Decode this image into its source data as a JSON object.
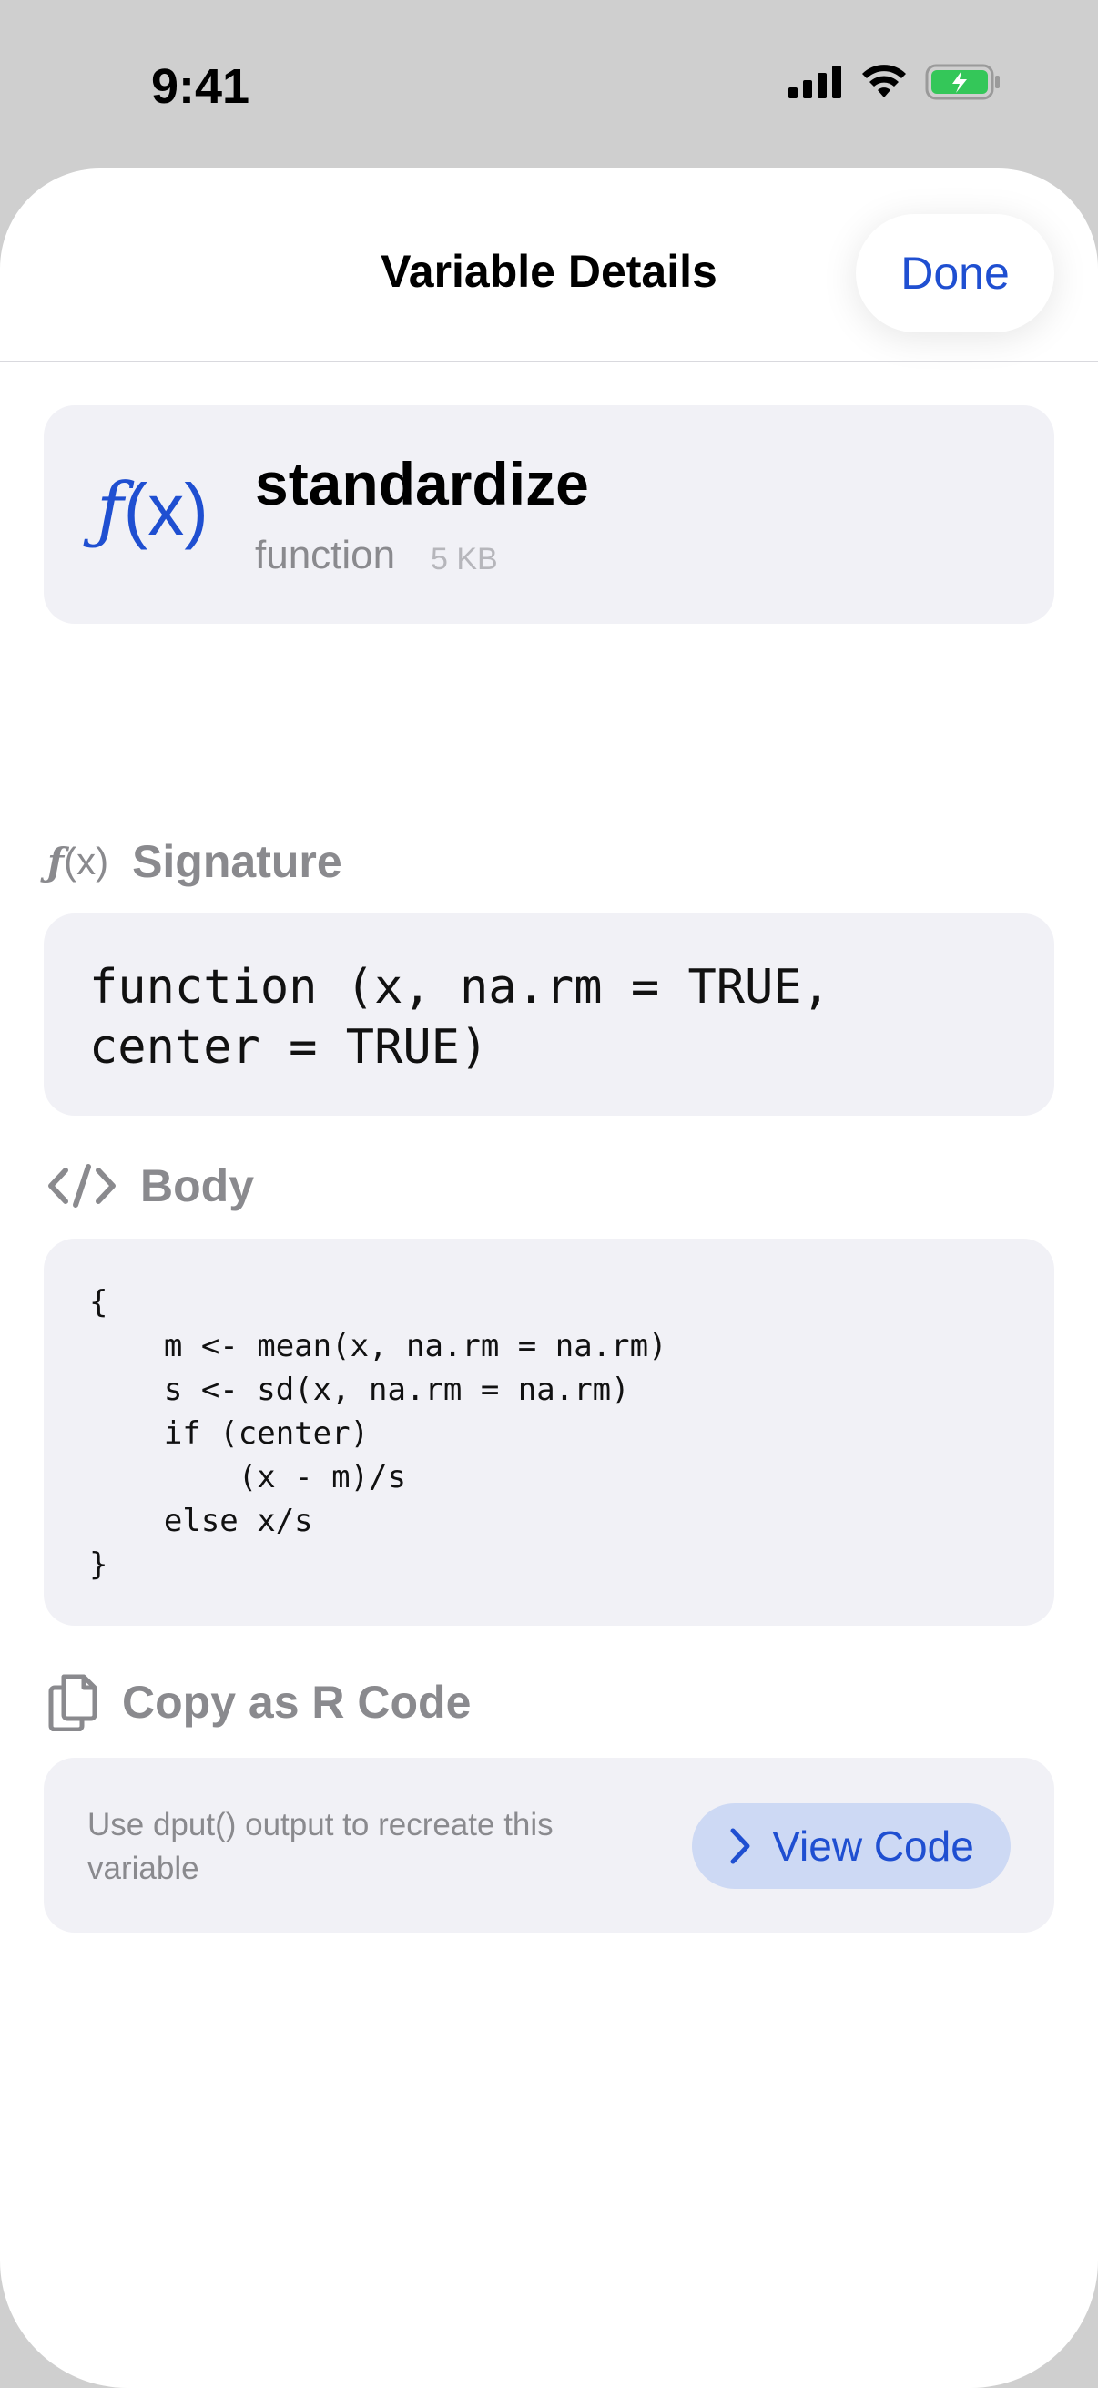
{
  "status": {
    "time": "9:41"
  },
  "nav": {
    "title": "Variable Details",
    "done_label": "Done"
  },
  "variable": {
    "name": "standardize",
    "type": "function",
    "size": "5 KB"
  },
  "signature": {
    "label": "Signature",
    "code": "function (x, na.rm = TRUE,\ncenter = TRUE)"
  },
  "body": {
    "label": "Body",
    "code": "{\n    m <- mean(x, na.rm = na.rm)\n    s <- sd(x, na.rm = na.rm)\n    if (center)\n        (x - m)/s\n    else x/s\n}"
  },
  "copy": {
    "label": "Copy as R Code",
    "description": "Use dput() output to recreate this variable",
    "button_label": "View Code"
  },
  "colors": {
    "accent": "#1f4fd1",
    "battery": "#34c759"
  }
}
